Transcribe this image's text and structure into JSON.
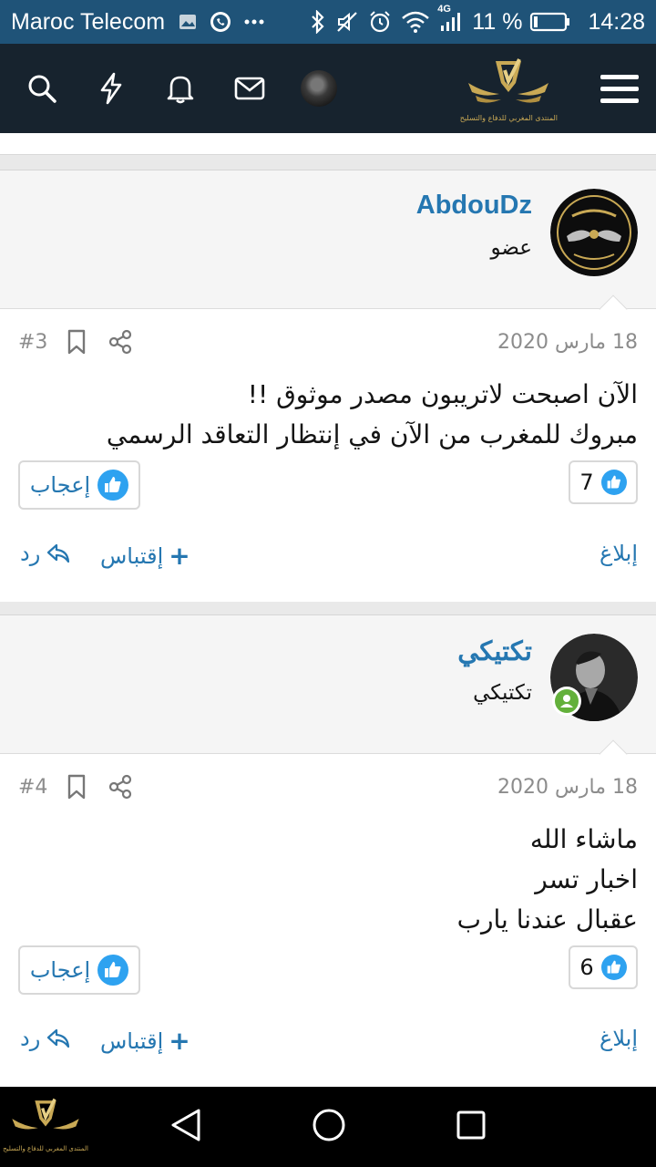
{
  "status_bar": {
    "carrier": "Maroc Telecom",
    "network": "4G",
    "battery_percent": "11 %",
    "time": "14:28",
    "icons": [
      "gallery-icon",
      "whatsapp-icon",
      "more-dots-icon",
      "bluetooth-icon",
      "mute-icon",
      "alarm-icon",
      "wifi-icon",
      "signal-icon",
      "battery-icon"
    ]
  },
  "header": {
    "icons": [
      "search-icon",
      "flash-icon",
      "bell-icon",
      "mail-icon",
      "avatar",
      "site-logo",
      "menu-icon"
    ],
    "logo_caption": "المنتدى المغربي للدفاع والتسليح"
  },
  "posts": [
    {
      "username": "AbdouDz",
      "user_title": "عضو",
      "avatar": "algerian-air-force-avatar",
      "date": "18 مارس 2020",
      "number": "#3",
      "lines": [
        "الآن اصبحت لاتريبون مصدر موثوق !!",
        "مبروك للمغرب من الآن في إنتظار التعاقد الرسمي"
      ],
      "like_count": "7",
      "like_label": "إعجاب",
      "report_label": "إبلاغ",
      "quote_label": "إقتباس",
      "reply_label": "رد",
      "online": false
    },
    {
      "username": "تكتيكي",
      "user_title": "تكتيكي",
      "avatar": "photo-avatar",
      "date": "18 مارس 2020",
      "number": "#4",
      "lines": [
        "ماشاء الله",
        "اخبار تسر",
        "عقبال عندنا يارب"
      ],
      "like_count": "6",
      "like_label": "إعجاب",
      "report_label": "إبلاغ",
      "quote_label": "إقتباس",
      "reply_label": "رد",
      "online": true
    }
  ],
  "nav_bar": {
    "icons": [
      "back-icon",
      "home-icon",
      "recents-icon"
    ],
    "logo_caption": "المنتدى المغربي للدفاع والتسليح"
  },
  "colors": {
    "status_bar": "#1f5378",
    "header": "#17232e",
    "link": "#2577b1",
    "like": "#2ea2f0"
  }
}
